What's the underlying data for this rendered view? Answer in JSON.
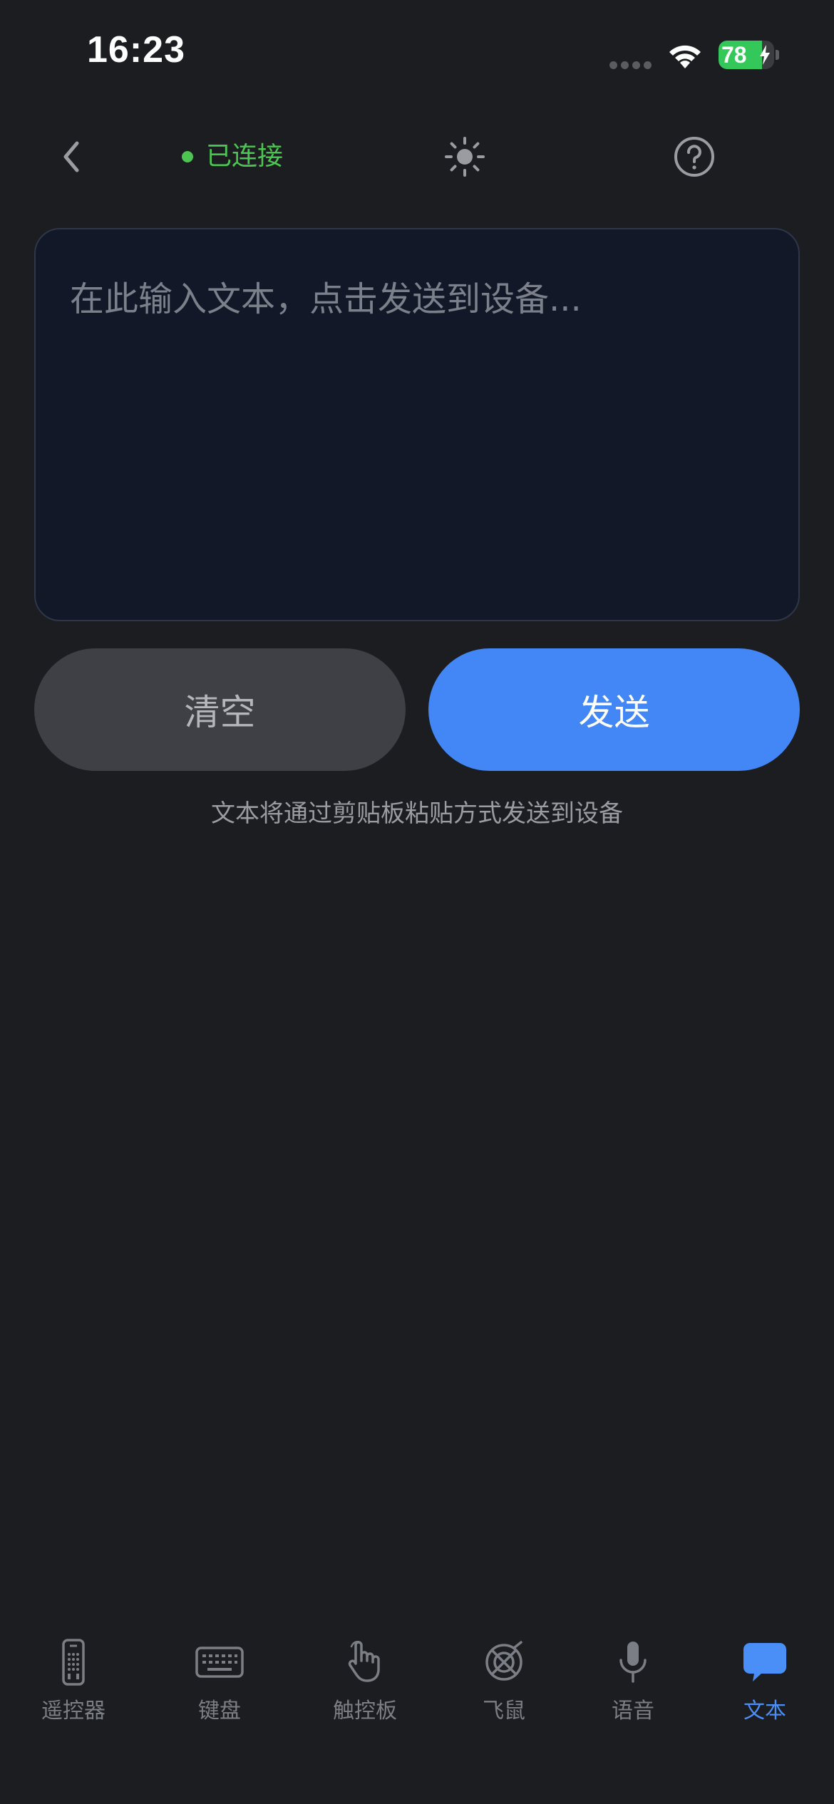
{
  "status_bar": {
    "time": "16:23",
    "battery": "78",
    "battery_level": 0.78
  },
  "nav": {
    "connection_label": "已连接",
    "connection_color": "#4cc552"
  },
  "input": {
    "placeholder": "在此输入文本，点击发送到设备...",
    "value": ""
  },
  "actions": {
    "clear_label": "清空",
    "send_label": "发送",
    "hint": "文本将通过剪贴板粘贴方式发送到设备"
  },
  "tabs": [
    {
      "label": "遥控器",
      "icon": "remote-icon",
      "active": false
    },
    {
      "label": "键盘",
      "icon": "keyboard-icon",
      "active": false
    },
    {
      "label": "触控板",
      "icon": "hand-pointer-icon",
      "active": false
    },
    {
      "label": "飞鼠",
      "icon": "air-mouse-icon",
      "active": false
    },
    {
      "label": "语音",
      "icon": "microphone-icon",
      "active": false
    },
    {
      "label": "文本",
      "icon": "chat-bubble-icon",
      "active": true
    }
  ],
  "colors": {
    "background": "#1b1d21",
    "accent": "#4287f5",
    "tab_active": "#4a8ff7",
    "tab_inactive": "#7b7e85"
  }
}
